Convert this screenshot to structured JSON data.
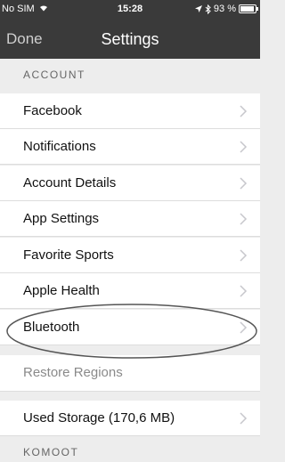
{
  "status": {
    "carrier": "No SIM",
    "time": "15:28",
    "battery": "93 %"
  },
  "nav": {
    "back_label": "Done",
    "title": "Settings"
  },
  "sections": {
    "account": "ACCOUNT",
    "komoot": "KOMOOT"
  },
  "account_items": [
    {
      "label": "Facebook"
    },
    {
      "label": "Notifications"
    },
    {
      "label": "Account Details"
    },
    {
      "label": "App Settings"
    },
    {
      "label": "Favorite Sports"
    },
    {
      "label": "Apple Health"
    },
    {
      "label": "Bluetooth"
    }
  ],
  "restore": {
    "label": "Restore Regions"
  },
  "storage": {
    "label": "Used Storage (170,6 MB)"
  },
  "colors": {
    "nav_background": "#3a3a3a",
    "highlight_oval": "#555555"
  }
}
